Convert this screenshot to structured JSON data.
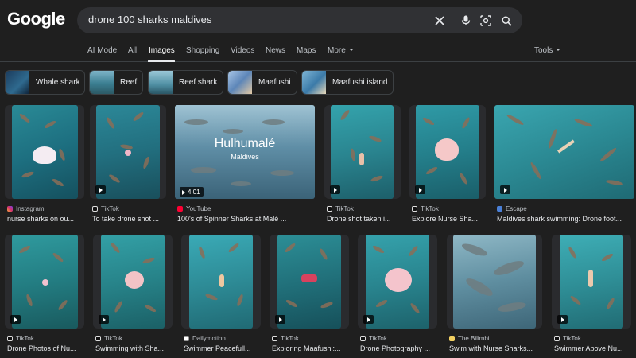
{
  "logo": "Google",
  "search": {
    "query": "drone 100 sharks maldives"
  },
  "tabs": [
    {
      "label": "AI Mode"
    },
    {
      "label": "All"
    },
    {
      "label": "Images"
    },
    {
      "label": "Shopping"
    },
    {
      "label": "Videos"
    },
    {
      "label": "News"
    },
    {
      "label": "Maps"
    },
    {
      "label": "More"
    }
  ],
  "tools_label": "Tools",
  "chips": [
    {
      "label": "Whale shark"
    },
    {
      "label": "Reef"
    },
    {
      "label": "Reef shark"
    },
    {
      "label": "Maafushi"
    },
    {
      "label": "Maafushi island"
    }
  ],
  "row1": [
    {
      "source": "Instagram",
      "title": "nurse sharks on ou..."
    },
    {
      "source": "TikTok",
      "title": "To take drone shot ..."
    },
    {
      "source": "YouTube",
      "title": "100's of Spinner Sharks at Malé ...",
      "duration": "4:01",
      "overlay_title": "Hulhumalé",
      "overlay_sub": "Maldives"
    },
    {
      "source": "TikTok",
      "title": "Drone shot taken i..."
    },
    {
      "source": "TikTok",
      "title": "Explore Nurse Sha..."
    },
    {
      "source": "Escape",
      "title": "Maldives shark swimming: Drone foot..."
    }
  ],
  "row2": [
    {
      "source": "TikTok",
      "title": "Drone Photos of Nu..."
    },
    {
      "source": "TikTok",
      "title": "Swimming with Sha..."
    },
    {
      "source": "Dailymotion",
      "title": "Swimmer Peacefull..."
    },
    {
      "source": "TikTok",
      "title": "Exploring Maafushi:..."
    },
    {
      "source": "TikTok",
      "title": "Drone Photography ..."
    },
    {
      "source": "The Bilimbi",
      "title": "Swim with Nurse Sharks..."
    },
    {
      "source": "TikTok",
      "title": "Swimmer Above Nu..."
    }
  ],
  "colors": {
    "background": "#1f1f1f",
    "search_bg": "#303134",
    "text": "#e8eaed",
    "muted": "#bdc1c6"
  },
  "icons": [
    "clear-icon",
    "microphone-icon",
    "lens-icon",
    "search-icon",
    "play-icon"
  ]
}
